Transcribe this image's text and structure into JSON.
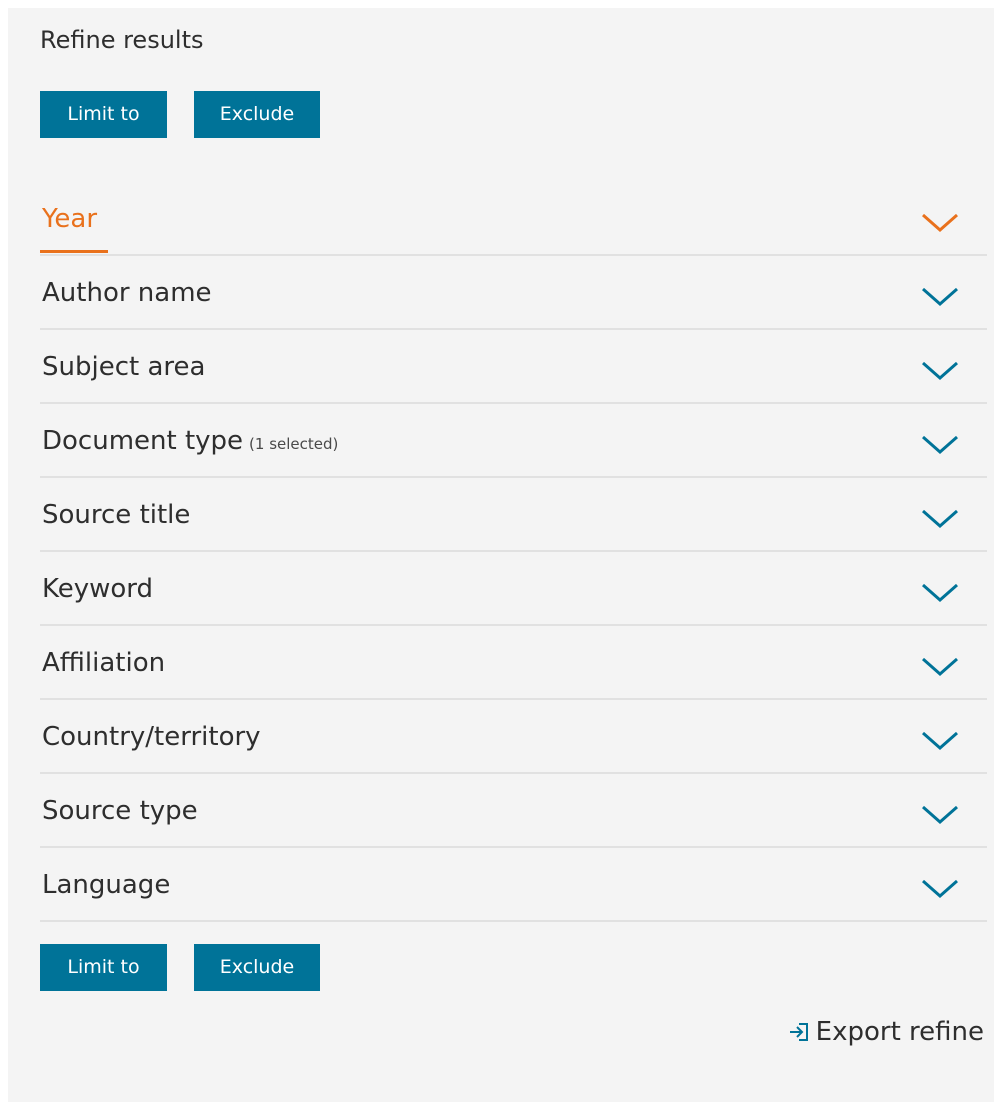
{
  "panel": {
    "title": "Refine results",
    "limit_label": "Limit to",
    "exclude_label": "Exclude",
    "export_label": "Export refine",
    "export_icon": "export-arrow-icon"
  },
  "facets": [
    {
      "label": "Year",
      "note": "",
      "active": true
    },
    {
      "label": "Author name",
      "note": ""
    },
    {
      "label": "Subject area",
      "note": ""
    },
    {
      "label": "Document type",
      "note": "(1 selected)"
    },
    {
      "label": "Source title",
      "note": ""
    },
    {
      "label": "Keyword",
      "note": ""
    },
    {
      "label": "Affiliation",
      "note": ""
    },
    {
      "label": "Country/territory",
      "note": ""
    },
    {
      "label": "Source type",
      "note": ""
    },
    {
      "label": "Language",
      "note": ""
    }
  ],
  "colors": {
    "button": "#007398",
    "active": "#e9711c",
    "chevron": "#007398",
    "panel_bg": "#f4f4f4"
  }
}
